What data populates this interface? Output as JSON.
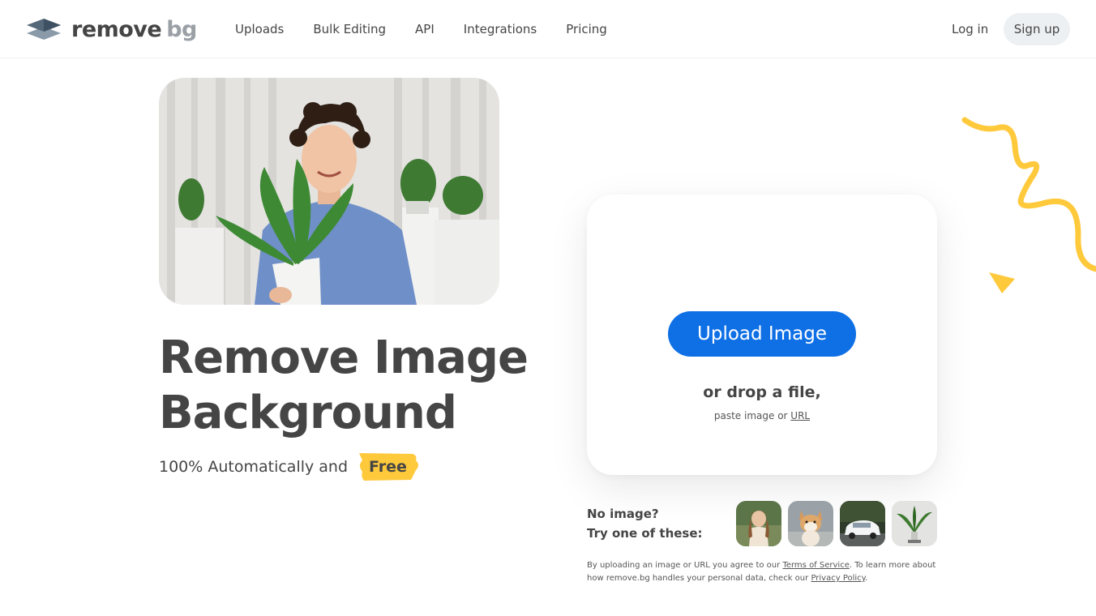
{
  "brand": {
    "logo_word1": "remove",
    "logo_word2": "bg",
    "accent_color": "#0f70e6",
    "highlight_color": "#ffc93c"
  },
  "nav": {
    "items": [
      "Uploads",
      "Bulk Editing",
      "API",
      "Integrations",
      "Pricing"
    ],
    "login": "Log in",
    "signup": "Sign up"
  },
  "hero": {
    "photo_icon": "man-holding-plant-photo",
    "headline_line1": "Remove Image",
    "headline_line2": "Background",
    "subline": "100% Automatically and",
    "free_badge": "Free"
  },
  "upload": {
    "button_label": "Upload Image",
    "drop_text": "or drop a file,",
    "paste_prefix": "paste image or",
    "paste_link": "URL"
  },
  "samples": {
    "prompt_line1": "No image?",
    "prompt_line2": "Try one of these:",
    "items": [
      "woman-sample-icon",
      "dog-sample-icon",
      "car-sample-icon",
      "plant-sample-icon"
    ]
  },
  "legal": {
    "part1": "By uploading an image or URL you agree to our",
    "tos_link": "Terms of Service",
    "part2": ". To learn more about how remove.bg handles your personal data, check our",
    "privacy_link": "Privacy Policy",
    "part3": "."
  }
}
